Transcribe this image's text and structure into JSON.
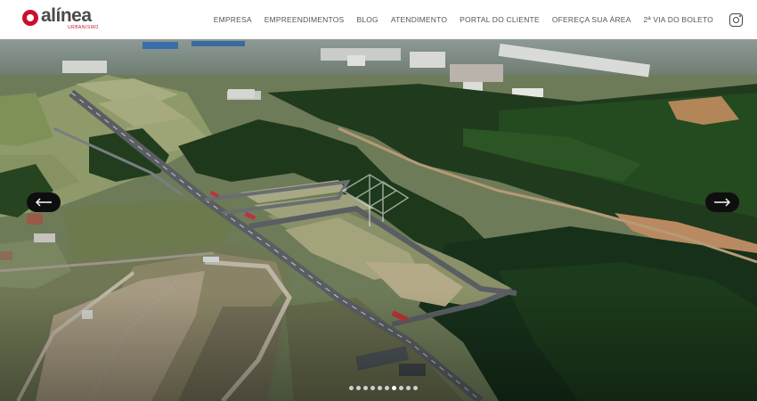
{
  "brand": {
    "name": "alínea",
    "tagline": "URBANISMO",
    "accent": "#c8102e"
  },
  "nav": {
    "items": [
      "EMPRESA",
      "EMPREENDIMENTOS",
      "BLOG",
      "ATENDIMENTO",
      "PORTAL DO CLIENTE",
      "OFEREÇA SUA ÁREA",
      "2ª VIA DO BOLETO"
    ],
    "social": "instagram-icon"
  },
  "hero": {
    "prev_icon": "arrow-left-icon",
    "next_icon": "arrow-right-icon",
    "slide_count": 10,
    "active_slide": 6
  }
}
